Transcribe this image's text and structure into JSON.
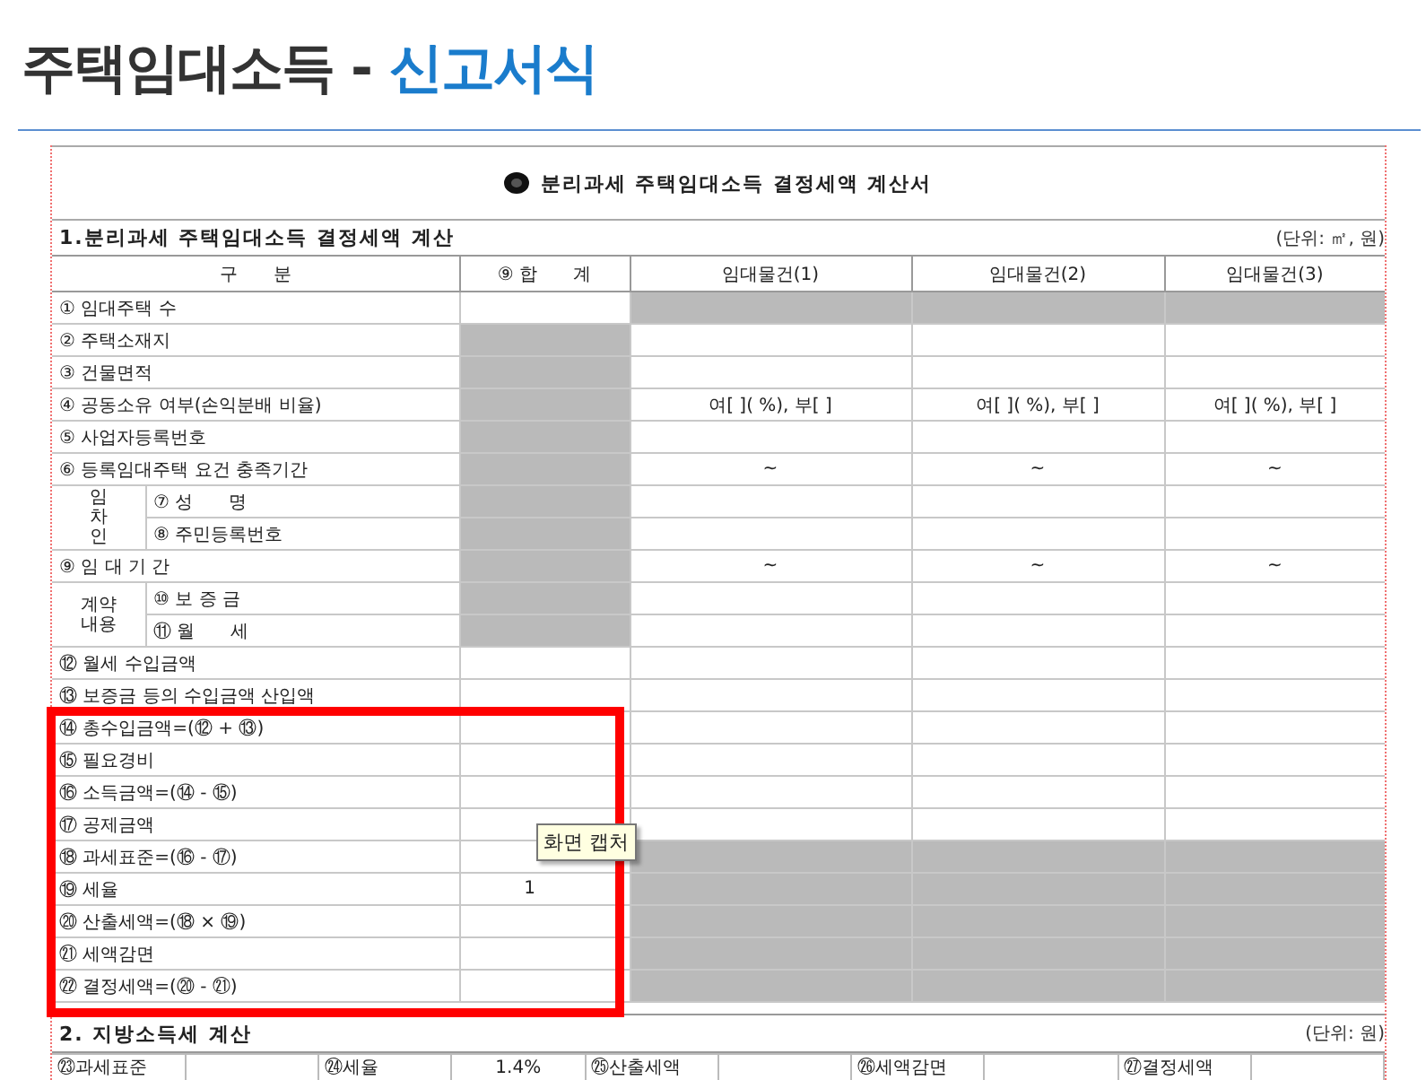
{
  "heading": {
    "title": "주택임대소득 -",
    "subtitle": "신고서식"
  },
  "document": {
    "title": "분리과세 주택임대소득 결정세액 계산서",
    "section1": {
      "title": "1.분리과세 주택임대소득 결정세액 계산",
      "unit": "(단위: ㎡, 원)",
      "columns": [
        "구　　분",
        "⑨ 합　　계",
        "임대물건(1)",
        "임대물건(2)",
        "임대물건(3)"
      ],
      "rows": [
        {
          "kind": "row",
          "label": "① 임대주택 수",
          "total": {
            "shaded": false
          },
          "items": [
            {
              "shaded": true
            },
            {
              "shaded": true
            },
            {
              "shaded": true
            }
          ]
        },
        {
          "kind": "row",
          "label": "② 주택소재지",
          "total": {
            "shaded": true
          },
          "items": [
            {
              "shaded": false
            },
            {
              "shaded": false
            },
            {
              "shaded": false
            }
          ]
        },
        {
          "kind": "row",
          "label": "③ 건물면적",
          "total": {
            "shaded": true
          },
          "items": [
            {
              "shaded": false
            },
            {
              "shaded": false
            },
            {
              "shaded": false
            }
          ]
        },
        {
          "kind": "row",
          "label": "④ 공동소유 여부(손익분배 비율)",
          "total": {
            "shaded": true
          },
          "items": [
            {
              "shaded": false,
              "text": "여[ ]( %), 부[ ]"
            },
            {
              "shaded": false,
              "text": "여[ ]( %), 부[ ]"
            },
            {
              "shaded": false,
              "text": "여[ ]( %), 부[ ]"
            }
          ]
        },
        {
          "kind": "row",
          "label": "⑤ 사업자등록번호",
          "total": {
            "shaded": true
          },
          "items": [
            {
              "shaded": false
            },
            {
              "shaded": false
            },
            {
              "shaded": false
            }
          ]
        },
        {
          "kind": "row",
          "label": "⑥ 등록임대주택 요건 충족기간",
          "total": {
            "shaded": true
          },
          "items": [
            {
              "shaded": false,
              "text": "~"
            },
            {
              "shaded": false,
              "text": "~"
            },
            {
              "shaded": false,
              "text": "~"
            }
          ]
        },
        {
          "kind": "group",
          "label": "임차인",
          "vertical": true,
          "rows": [
            {
              "label": "⑦ 성　　명",
              "total": {
                "shaded": true
              },
              "items": [
                {
                  "shaded": false
                },
                {
                  "shaded": false
                },
                {
                  "shaded": false
                }
              ]
            },
            {
              "label": "⑧ 주민등록번호",
              "total": {
                "shaded": true
              },
              "items": [
                {
                  "shaded": false
                },
                {
                  "shaded": false
                },
                {
                  "shaded": false
                }
              ]
            }
          ]
        },
        {
          "kind": "row",
          "label": "⑨ 임 대 기 간",
          "total": {
            "shaded": true
          },
          "items": [
            {
              "shaded": false,
              "text": "~"
            },
            {
              "shaded": false,
              "text": "~"
            },
            {
              "shaded": false,
              "text": "~"
            }
          ]
        },
        {
          "kind": "group",
          "label": "계약내용",
          "vertical": false,
          "rows": [
            {
              "label": "⑩ 보 증 금",
              "total": {
                "shaded": true
              },
              "items": [
                {
                  "shaded": false
                },
                {
                  "shaded": false
                },
                {
                  "shaded": false
                }
              ]
            },
            {
              "label": "⑪ 월　　세",
              "total": {
                "shaded": true
              },
              "items": [
                {
                  "shaded": false
                },
                {
                  "shaded": false
                },
                {
                  "shaded": false
                }
              ]
            }
          ]
        },
        {
          "kind": "row",
          "label": "⑫ 월세 수입금액",
          "total": {
            "shaded": false
          },
          "items": [
            {
              "shaded": false
            },
            {
              "shaded": false
            },
            {
              "shaded": false
            }
          ]
        },
        {
          "kind": "row",
          "label": "⑬ 보증금 등의 수입금액 산입액",
          "total": {
            "shaded": false
          },
          "items": [
            {
              "shaded": false
            },
            {
              "shaded": false
            },
            {
              "shaded": false
            }
          ]
        },
        {
          "kind": "row",
          "label": "⑭ 총수입금액=(⑫ + ⑬)",
          "total": {
            "shaded": false
          },
          "items": [
            {
              "shaded": false
            },
            {
              "shaded": false
            },
            {
              "shaded": false
            }
          ]
        },
        {
          "kind": "row",
          "label": "⑮ 필요경비",
          "total": {
            "shaded": false
          },
          "items": [
            {
              "shaded": false
            },
            {
              "shaded": false
            },
            {
              "shaded": false
            }
          ]
        },
        {
          "kind": "row",
          "label": "⑯ 소득금액=(⑭ - ⑮)",
          "total": {
            "shaded": false
          },
          "items": [
            {
              "shaded": false
            },
            {
              "shaded": false
            },
            {
              "shaded": false
            }
          ]
        },
        {
          "kind": "row",
          "label": "⑰ 공제금액",
          "total": {
            "shaded": false
          },
          "items": [
            {
              "shaded": false
            },
            {
              "shaded": false
            },
            {
              "shaded": false
            }
          ]
        },
        {
          "kind": "row",
          "label": "⑱ 과세표준=(⑯ - ⑰)",
          "total": {
            "shaded": false
          },
          "items": [
            {
              "shaded": true
            },
            {
              "shaded": true
            },
            {
              "shaded": true
            }
          ]
        },
        {
          "kind": "row",
          "label": "⑲ 세율",
          "total": {
            "shaded": false,
            "text": "1"
          },
          "items": [
            {
              "shaded": true
            },
            {
              "shaded": true
            },
            {
              "shaded": true
            }
          ]
        },
        {
          "kind": "row",
          "label": "⑳ 산출세액=(⑱ × ⑲)",
          "total": {
            "shaded": false
          },
          "items": [
            {
              "shaded": true
            },
            {
              "shaded": true
            },
            {
              "shaded": true
            }
          ]
        },
        {
          "kind": "row",
          "label": "㉑ 세액감면",
          "total": {
            "shaded": false
          },
          "items": [
            {
              "shaded": true
            },
            {
              "shaded": true
            },
            {
              "shaded": true
            }
          ]
        },
        {
          "kind": "row",
          "label": "㉒ 결정세액=(⑳ - ㉑)",
          "total": {
            "shaded": false
          },
          "items": [
            {
              "shaded": true
            },
            {
              "shaded": true
            },
            {
              "shaded": true
            }
          ]
        }
      ]
    },
    "section2": {
      "title": "2. 지방소득세 계산",
      "unit": "(단위: 원)",
      "cells": [
        {
          "kind": "label",
          "text": "㉓과세표준"
        },
        {
          "kind": "value"
        },
        {
          "kind": "label",
          "text": "㉔세율"
        },
        {
          "kind": "value",
          "text": "1.4%"
        },
        {
          "kind": "label",
          "text": "㉕산출세액"
        },
        {
          "kind": "value"
        },
        {
          "kind": "label",
          "text": "㉖세액감면"
        },
        {
          "kind": "value"
        },
        {
          "kind": "label",
          "text": "㉗결정세액"
        },
        {
          "kind": "value"
        }
      ]
    }
  },
  "tooltip": "화면 캡처"
}
